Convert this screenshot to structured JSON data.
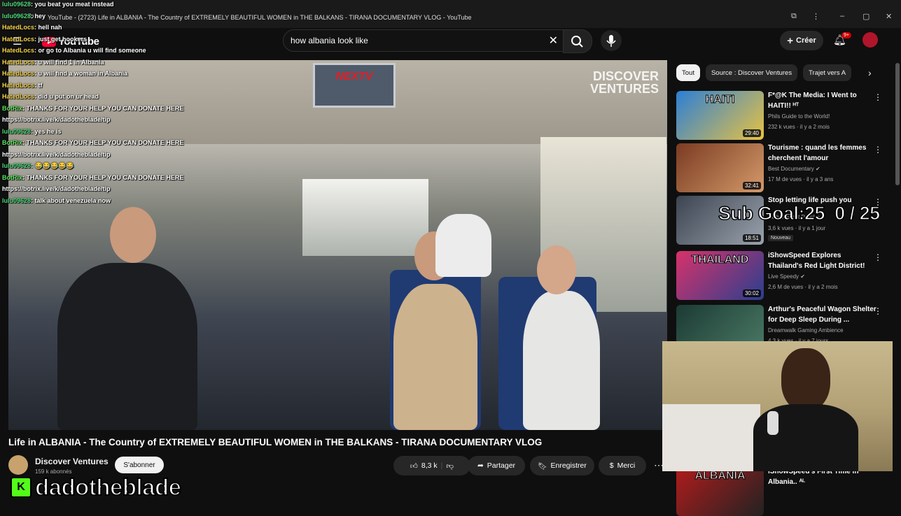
{
  "window": {
    "title": "YouTube - (2723) Life in ALBANIA - The Country of EXTREMELY BEAUTIFUL WOMEN in THE BALKANS - TIRANA DOCUMENTARY VLOG - YouTube"
  },
  "masthead": {
    "logo_text": "YouTube",
    "search_query": "how albania look like",
    "create_label": "Créer",
    "notification_count": "9+"
  },
  "video": {
    "overlay_screen_text": "NEXTV",
    "watermark_line1": "DISCOVER",
    "watermark_line2": "VENTURES",
    "title": "Life in ALBANIA - The Country of EXTREMELY BEAUTIFUL WOMEN in THE BALKANS - TIRANA DOCUMENTARY VLOG",
    "channel": "Discover Ventures",
    "subscribers": "159 k abonnés",
    "subscribe_label": "S'abonner",
    "like_count": "8,3 k",
    "share_label": "Partager",
    "save_label": "Enregistrer",
    "thanks_label": "Merci"
  },
  "chat": [
    {
      "user": "lulu09628",
      "message": ": you beat you meat instead",
      "color": "#4fdc7c"
    },
    {
      "user": "lulu09628",
      "message": ": hey",
      "color": "#4fdc7c"
    },
    {
      "user": "HatedLocs",
      "message": ": hell nah",
      "color": "#f7d54a"
    },
    {
      "user": "HatedLocs",
      "message": ": just get hookers",
      "color": "#f7d54a"
    },
    {
      "user": "HatedLocs",
      "message": ": or go to Albania u will find someone",
      "color": "#f7d54a"
    },
    {
      "user": "HatedLocs",
      "message": ": u will find 1 in Albania",
      "color": "#f7d54a"
    },
    {
      "user": "HatedLocs",
      "message": ": u will find a woman in Albania",
      "color": "#f7d54a"
    },
    {
      "user": "HatedLocs",
      "message": ": tf",
      "color": "#f7d54a"
    },
    {
      "user": "HatedLocs",
      "message": ": did u put on ur head",
      "color": "#f7d54a"
    },
    {
      "user": "BotRix",
      "message": ": THANKS FOR YOUR HELP YOU CAN DONATE HERE",
      "color": "#5be35b"
    },
    {
      "user": "",
      "message": "https://botrix.live/k/dadotheblade/tip",
      "color": "#ffffff"
    },
    {
      "user": "lulu09628",
      "message": ": yes he is",
      "color": "#4fdc7c"
    },
    {
      "user": "BotRix",
      "message": ": THANKS FOR YOUR HELP YOU CAN DONATE HERE",
      "color": "#5be35b"
    },
    {
      "user": "",
      "message": "https://botrix.live/k/dadotheblade/tip",
      "color": "#ffffff"
    },
    {
      "user": "lulu09628",
      "message": ": 😂😂😂😂😂",
      "color": "#4fdc7c"
    },
    {
      "user": "BotRix",
      "message": ": THANKS FOR YOUR HELP YOU CAN DONATE HERE",
      "color": "#5be35b"
    },
    {
      "user": "",
      "message": "https://botrix.live/k/dadotheblade/tip",
      "color": "#ffffff"
    },
    {
      "user": "lulu09628",
      "message": ": talk about venezuela now",
      "color": "#4fdc7c"
    }
  ],
  "streamer": {
    "platform_icon": "K",
    "name": "dadotheblade"
  },
  "sidebar": {
    "chips": [
      "Tout",
      "Source : Discover Ventures",
      "Trajet vers A"
    ],
    "recommendations": [
      {
        "title": "F*@K The Media: I Went to HAITI!! ᴴᵀ",
        "channel": "Phils Guide to the World!",
        "meta": "232 k vues · il y a 2 mois",
        "duration": "29:40",
        "thumb_text": "HAITI",
        "colors": [
          "#2b7fd6",
          "#e8c243"
        ]
      },
      {
        "title": "Tourisme : quand les femmes cherchent l'amour",
        "channel": "Best Documentary ✔",
        "meta": "17 M de vues · il y a 3 ans",
        "duration": "32:41",
        "thumb_text": "",
        "colors": [
          "#7a3b22",
          "#d49a6a"
        ]
      },
      {
        "title": "Stop letting life push you",
        "channel": "Daily Perfect Psyche",
        "meta": "3,6 k vues · il y a 1 jour",
        "duration": "18:51",
        "thumb_text": "",
        "badge": "Nouveau",
        "colors": [
          "#3b4450",
          "#9aa3ad"
        ]
      },
      {
        "title": "iShowSpeed Explores Thailand's Red Light District!",
        "channel": "Live Speedy ✔",
        "meta": "2,6 M de vues · il y a 2 mois",
        "duration": "30:02",
        "thumb_text": "THAILAND",
        "colors": [
          "#d8326a",
          "#2a3f8f"
        ]
      },
      {
        "title": "Arthur's Peaceful Wagon Shelter for Deep Sleep During ...",
        "channel": "Dreamwalk Gaming Ambience",
        "meta": "4,3 k vues · il y a 7 jours",
        "duration": "",
        "thumb_text": "",
        "colors": [
          "#1c3a33",
          "#4a7a66"
        ]
      },
      {
        "title": "iShowSpeed's First Time in Albania.. ᴬᴸ",
        "channel": "",
        "meta": "",
        "duration": "",
        "thumb_text": "ALBANIA",
        "colors": [
          "#b01c1c",
          "#222"
        ]
      }
    ]
  },
  "subgoal": {
    "label": "Sub Goal:",
    "current": "25",
    "separator": "0 / 25"
  }
}
